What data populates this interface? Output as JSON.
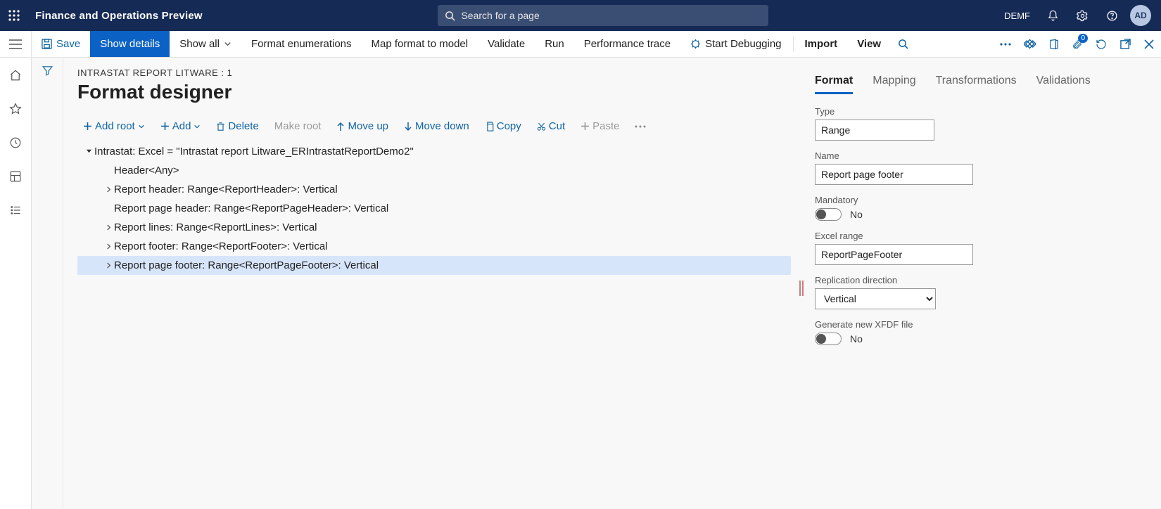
{
  "header": {
    "app_title": "Finance and Operations Preview",
    "search_placeholder": "Search for a page",
    "env": "DEMF",
    "avatar_initials": "AD"
  },
  "cmdbar": {
    "save": "Save",
    "show_details": "Show details",
    "show_all": "Show all",
    "format_enum": "Format enumerations",
    "map_format": "Map format to model",
    "validate": "Validate",
    "run": "Run",
    "perf_trace": "Performance trace",
    "start_debug": "Start Debugging",
    "import": "Import",
    "view": "View",
    "attach_badge": "0"
  },
  "page": {
    "breadcrumb": "INTRASTAT REPORT LITWARE : 1",
    "title": "Format designer"
  },
  "tree_toolbar": {
    "add_root": "Add root",
    "add": "Add",
    "delete": "Delete",
    "make_root": "Make root",
    "move_up": "Move up",
    "move_down": "Move down",
    "copy": "Copy",
    "cut": "Cut",
    "paste": "Paste"
  },
  "tree": [
    {
      "level": 1,
      "expand": "open",
      "label": "Intrastat: Excel = \"Intrastat report Litware_ERIntrastatReportDemo2\""
    },
    {
      "level": 2,
      "expand": "none",
      "label": "Header<Any>"
    },
    {
      "level": 2,
      "expand": "closed",
      "label": "Report header: Range<ReportHeader>: Vertical"
    },
    {
      "level": 2,
      "expand": "none",
      "label": "Report page header: Range<ReportPageHeader>: Vertical"
    },
    {
      "level": 2,
      "expand": "closed",
      "label": "Report lines: Range<ReportLines>: Vertical"
    },
    {
      "level": 2,
      "expand": "closed",
      "label": "Report footer: Range<ReportFooter>: Vertical"
    },
    {
      "level": 2,
      "expand": "closed",
      "label": "Report page footer: Range<ReportPageFooter>: Vertical",
      "selected": true
    }
  ],
  "tabs": [
    "Format",
    "Mapping",
    "Transformations",
    "Validations"
  ],
  "active_tab": 0,
  "props": {
    "type_label": "Type",
    "type_value": "Range",
    "name_label": "Name",
    "name_value": "Report page footer",
    "mandatory_label": "Mandatory",
    "mandatory_value": "No",
    "excel_label": "Excel range",
    "excel_value": "ReportPageFooter",
    "repl_label": "Replication direction",
    "repl_value": "Vertical",
    "xfdf_label": "Generate new XFDF file",
    "xfdf_value": "No"
  }
}
